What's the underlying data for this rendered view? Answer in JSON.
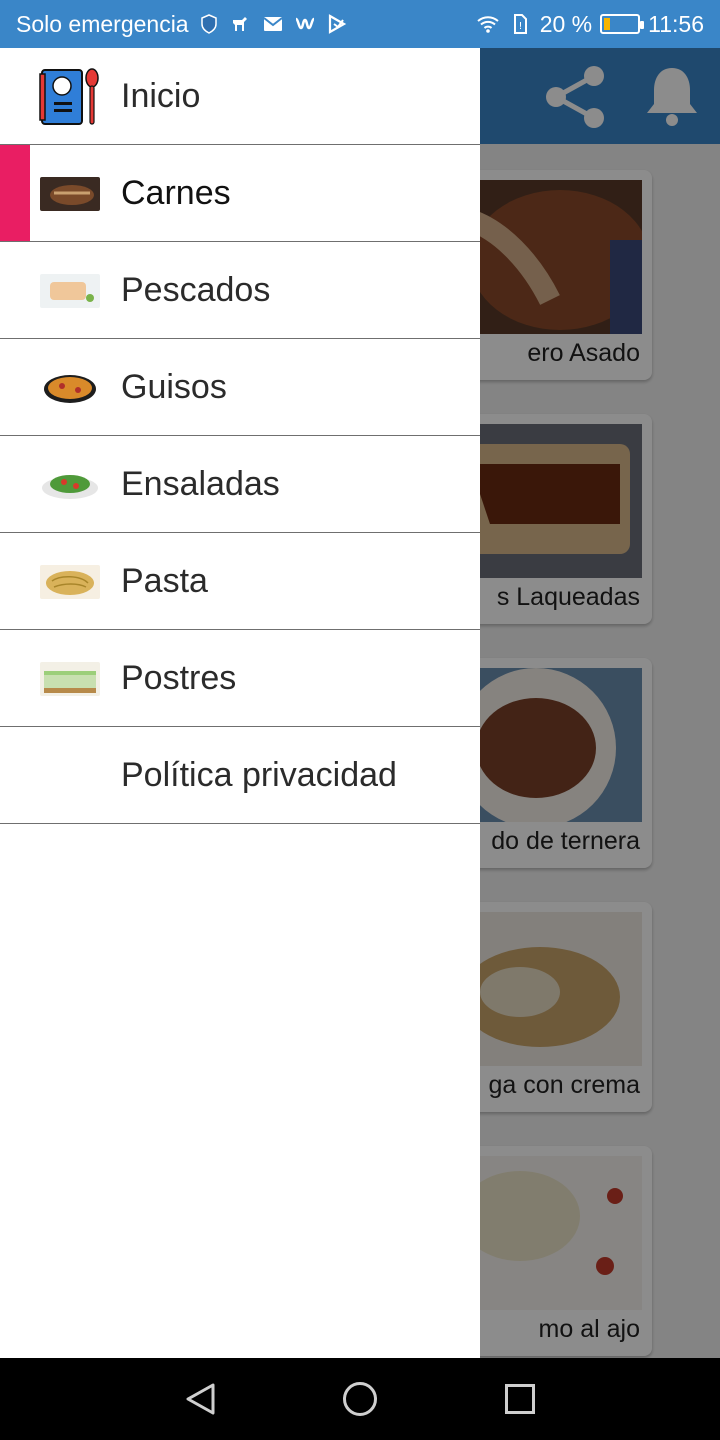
{
  "status_bar": {
    "carrier": "Solo emergencia",
    "battery": "20 %",
    "battery_level": 0.2,
    "time": "11:56",
    "icons": [
      "shield-icon",
      "runner-icon",
      "mail-icon",
      "w-icon",
      "play-icon",
      "wifi-icon",
      "sim-icon",
      "battery-icon"
    ]
  },
  "app": {
    "toolbar_icons": [
      "share-icon",
      "bell-icon"
    ],
    "cards": [
      {
        "title": "ero Asado"
      },
      {
        "title": "s Laqueadas"
      },
      {
        "title": "do de ternera"
      },
      {
        "title": "ga con crema"
      },
      {
        "title": "mo al ajo"
      }
    ]
  },
  "drawer": {
    "items": [
      {
        "label": "Inicio",
        "icon": "recipe-book-icon"
      },
      {
        "label": "Carnes",
        "icon": "meat-thumbnail",
        "selected": true
      },
      {
        "label": "Pescados",
        "icon": "fish-thumbnail"
      },
      {
        "label": "Guisos",
        "icon": "paella-thumbnail"
      },
      {
        "label": "Ensaladas",
        "icon": "salad-thumbnail"
      },
      {
        "label": "Pasta",
        "icon": "pasta-thumbnail"
      },
      {
        "label": "Postres",
        "icon": "cake-thumbnail"
      },
      {
        "label": "Política privacidad",
        "icon": ""
      }
    ]
  },
  "colors": {
    "primary": "#3a86c8",
    "accent": "#e91e63"
  },
  "nav_bar": {
    "icons": [
      "back-icon",
      "home-icon",
      "recents-icon"
    ]
  }
}
